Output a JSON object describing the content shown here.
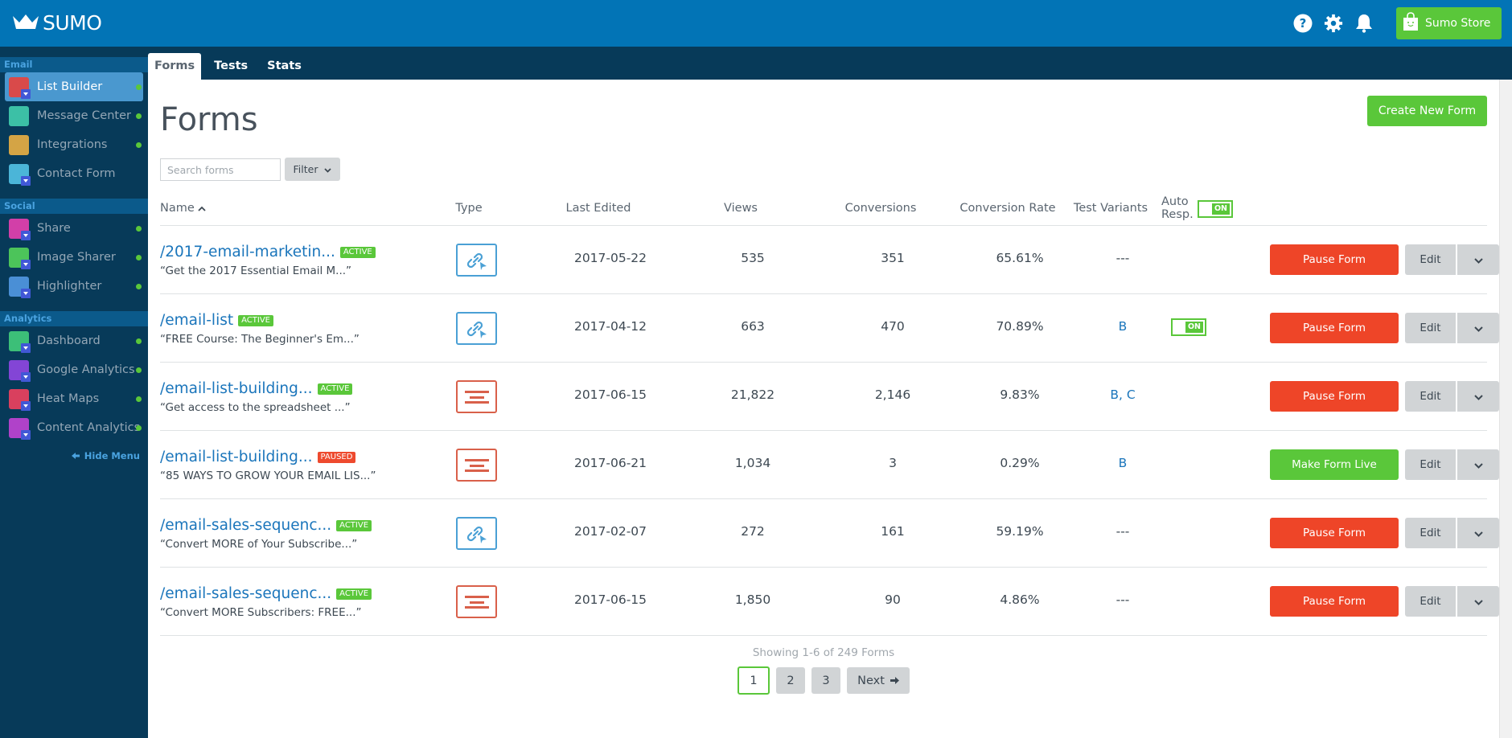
{
  "app": {
    "logo_text": "SUMO",
    "store_label": "Sumo Store"
  },
  "tabs": [
    {
      "label": "Forms",
      "active": true
    },
    {
      "label": "Tests",
      "active": false
    },
    {
      "label": "Stats",
      "active": false
    }
  ],
  "sidebar": {
    "sections": [
      {
        "title": "Email",
        "items": [
          {
            "label": "List Builder",
            "icon": "list-builder-icon",
            "color": "#d94a4a",
            "active": true,
            "dot": true,
            "gem": true
          },
          {
            "label": "Message Center",
            "icon": "message-center-icon",
            "color": "#3cc0a6",
            "active": false,
            "dot": true,
            "gem": false
          },
          {
            "label": "Integrations",
            "icon": "integrations-icon",
            "color": "#d4a445",
            "active": false,
            "dot": true,
            "gem": false
          },
          {
            "label": "Contact Form",
            "icon": "contact-form-icon",
            "color": "#4bb5d8",
            "active": false,
            "dot": false,
            "gem": true
          }
        ]
      },
      {
        "title": "Social",
        "items": [
          {
            "label": "Share",
            "icon": "share-icon",
            "color": "#d23fa8",
            "active": false,
            "dot": true,
            "gem": true
          },
          {
            "label": "Image Sharer",
            "icon": "image-sharer-icon",
            "color": "#4cc45a",
            "active": false,
            "dot": true,
            "gem": true
          },
          {
            "label": "Highlighter",
            "icon": "highlighter-icon",
            "color": "#4a8fd6",
            "active": false,
            "dot": true,
            "gem": true
          }
        ]
      },
      {
        "title": "Analytics",
        "items": [
          {
            "label": "Dashboard",
            "icon": "dashboard-icon",
            "color": "#3cbf78",
            "active": false,
            "dot": true,
            "gem": true
          },
          {
            "label": "Google Analytics",
            "icon": "google-analytics-icon",
            "color": "#8345d6",
            "active": false,
            "dot": true,
            "gem": true
          },
          {
            "label": "Heat Maps",
            "icon": "heat-maps-icon",
            "color": "#d9405e",
            "active": false,
            "dot": true,
            "gem": true
          },
          {
            "label": "Content Analytics",
            "icon": "content-analytics-icon",
            "color": "#b042c9",
            "active": false,
            "dot": true,
            "gem": true
          }
        ]
      }
    ],
    "hide_menu_label": "Hide Menu"
  },
  "main": {
    "title": "Forms",
    "create_button": "Create New Form",
    "search_placeholder": "Search forms",
    "search_value": "",
    "filter_label": "Filter",
    "columns": {
      "name": "Name",
      "type": "Type",
      "last_edited": "Last Edited",
      "views": "Views",
      "conversions": "Conversions",
      "conversion_rate": "Conversion Rate",
      "test_variants": "Test Variants",
      "auto_resp_line1": "Auto",
      "auto_resp_line2": "Resp.",
      "auto_resp_toggle": "ON"
    },
    "rows": [
      {
        "name": "/2017-email-marketin...",
        "status": "ACTIVE",
        "subtitle": "“Get the 2017 Essential Email M...”",
        "type": "link",
        "last_edited": "2017-05-22",
        "views": "535",
        "conversions": "351",
        "conversion_rate": "65.61%",
        "test_variants": "---",
        "auto_resp": "",
        "action": "Pause Form",
        "edit": "Edit"
      },
      {
        "name": "/email-list",
        "status": "ACTIVE",
        "subtitle": "“FREE Course: The Beginner's Em...”",
        "type": "link",
        "last_edited": "2017-04-12",
        "views": "663",
        "conversions": "470",
        "conversion_rate": "70.89%",
        "test_variants": "B",
        "auto_resp": "ON",
        "action": "Pause Form",
        "edit": "Edit"
      },
      {
        "name": "/email-list-building...",
        "status": "ACTIVE",
        "subtitle": "“Get access to the spreadsheet ...”",
        "type": "bar",
        "last_edited": "2017-06-15",
        "views": "21,822",
        "conversions": "2,146",
        "conversion_rate": "9.83%",
        "test_variants": "B, C",
        "auto_resp": "",
        "action": "Pause Form",
        "edit": "Edit"
      },
      {
        "name": "/email-list-building...",
        "status": "PAUSED",
        "subtitle": "“85 WAYS TO GROW YOUR EMAIL LIS...”",
        "type": "bar",
        "last_edited": "2017-06-21",
        "views": "1,034",
        "conversions": "3",
        "conversion_rate": "0.29%",
        "test_variants": "B",
        "auto_resp": "",
        "action": "Make Form Live",
        "edit": "Edit"
      },
      {
        "name": "/email-sales-sequenc...",
        "status": "ACTIVE",
        "subtitle": "“Convert MORE of Your Subscribe...”",
        "type": "link",
        "last_edited": "2017-02-07",
        "views": "272",
        "conversions": "161",
        "conversion_rate": "59.19%",
        "test_variants": "---",
        "auto_resp": "",
        "action": "Pause Form",
        "edit": "Edit"
      },
      {
        "name": "/email-sales-sequenc...",
        "status": "ACTIVE",
        "subtitle": "“Convert MORE Subscribers: FREE...”",
        "type": "bar",
        "last_edited": "2017-06-15",
        "views": "1,850",
        "conversions": "90",
        "conversion_rate": "4.86%",
        "test_variants": "---",
        "auto_resp": "",
        "action": "Pause Form",
        "edit": "Edit"
      }
    ],
    "pagination": {
      "summary": "Showing 1-6 of 249 Forms",
      "pages": [
        "1",
        "2",
        "3"
      ],
      "current": "1",
      "next_label": "Next"
    }
  },
  "colors": {
    "header_blue": "#0274b6",
    "nav_dark": "#073a59",
    "accent_green": "#5ac73a",
    "pause_red": "#ee4528",
    "link_blue": "#1a75bb"
  }
}
